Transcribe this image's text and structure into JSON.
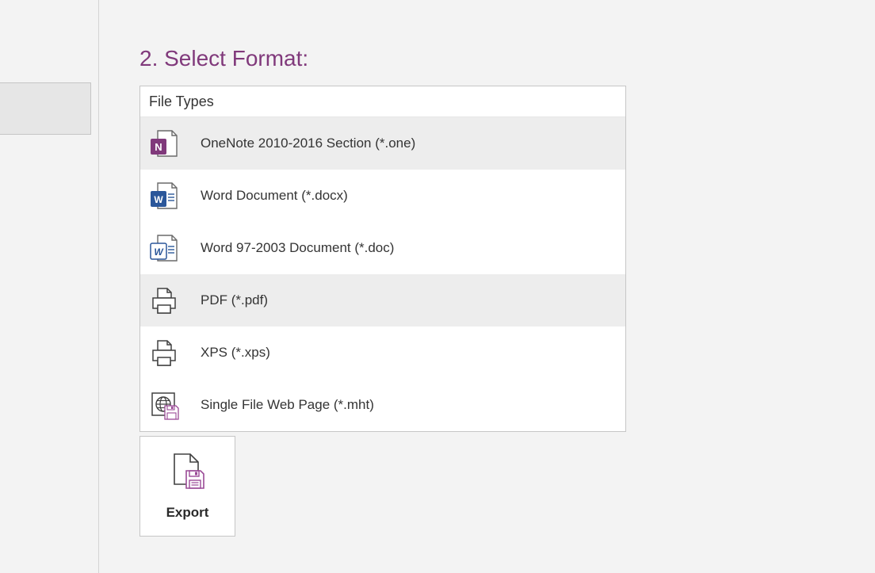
{
  "heading": "2. Select Format:",
  "file_types_header": "File Types",
  "file_types": [
    {
      "label": "OneNote 2010-2016 Section (*.one)",
      "icon": "onenote",
      "selected": true
    },
    {
      "label": "Word Document (*.docx)",
      "icon": "word-docx",
      "selected": false
    },
    {
      "label": "Word 97-2003 Document (*.doc)",
      "icon": "word-doc",
      "selected": false
    },
    {
      "label": "PDF (*.pdf)",
      "icon": "printer",
      "selected": true
    },
    {
      "label": "XPS (*.xps)",
      "icon": "printer",
      "selected": false
    },
    {
      "label": "Single File Web Page (*.mht)",
      "icon": "web-page",
      "selected": false
    }
  ],
  "export_label": "Export"
}
